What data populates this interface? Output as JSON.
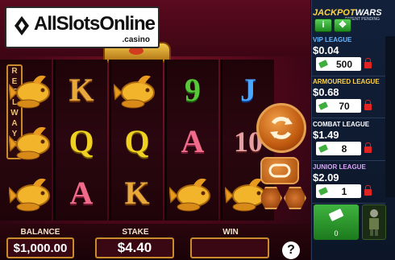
{
  "logo": {
    "text": "AllSlotsOnline",
    "sub": ".casino"
  },
  "reel_ways": {
    "letters": [
      "R",
      "E",
      "E",
      "L",
      "W",
      "A",
      "Y",
      "S"
    ]
  },
  "reels": [
    [
      "coin-fish",
      "coin-fish",
      "coin-fish"
    ],
    [
      "K",
      "Q",
      "A"
    ],
    [
      "coin-fish",
      "Q",
      "K"
    ],
    [
      "9",
      "A",
      "coin-fish"
    ],
    [
      "J",
      "10",
      "coin-fish"
    ]
  ],
  "bottom": {
    "balance_label": "BALANCE",
    "balance_value": "$1,000.00",
    "stake_label": "STAKE",
    "stake_value": "$4.40",
    "win_label": "WIN",
    "win_value": "",
    "help": "?"
  },
  "panel": {
    "title_a": "JACKPOT",
    "title_b": "WARS",
    "subtitle": "PATENT PENDING",
    "tabs": [
      "i",
      "✥"
    ],
    "leagues": [
      {
        "name": "VIP LEAGUE",
        "value": "$0.04",
        "tickets": "500",
        "color": "#6ab8ff"
      },
      {
        "name": "ARMOURED LEAGUE",
        "value": "$0.68",
        "tickets": "70",
        "color": "#ffd24a"
      },
      {
        "name": "COMBAT LEAGUE",
        "value": "$1.49",
        "tickets": "8",
        "color": "#ffffff"
      },
      {
        "name": "JUNIOR LEAGUE",
        "value": "$2.09",
        "tickets": "1",
        "color": "#e0a0ff"
      }
    ],
    "footer_count": "0"
  },
  "colors": {
    "gold": "#c98b2c",
    "green": "#3fae3f",
    "panel_bg": "#0c1628"
  }
}
